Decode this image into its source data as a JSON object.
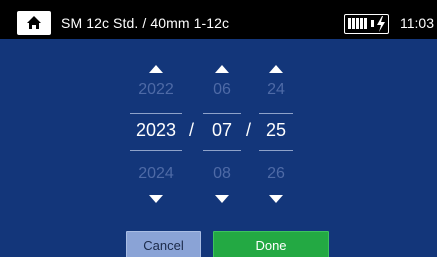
{
  "topbar": {
    "title": "SM 12c Std. / 40mm 1-12c",
    "time": "11:03",
    "home_icon": "home-icon",
    "battery_icon": "battery-charging-icon"
  },
  "picker": {
    "year": {
      "prev": "2022",
      "current": "2023",
      "next": "2024"
    },
    "month": {
      "prev": "06",
      "current": "07",
      "next": "08"
    },
    "day": {
      "prev": "24",
      "current": "25",
      "next": "26"
    },
    "separator": "/"
  },
  "buttons": {
    "cancel": "Cancel",
    "done": "Done"
  },
  "colors": {
    "background": "#13367a",
    "done": "#23a943",
    "cancel": "#8aa3d6"
  }
}
